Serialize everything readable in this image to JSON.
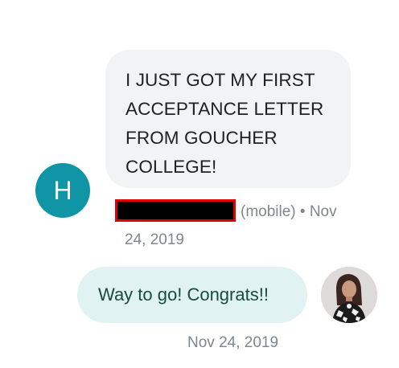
{
  "incoming": {
    "avatar_initial": "H",
    "avatar_color": "#0f95a5",
    "message": "I JUST GOT MY FIRST ACCEPTANCE LETTER FROM GOUCHER COLLEGE!",
    "sender_suffix": "(mobile) • Nov",
    "date_continued": "24, 2019"
  },
  "outgoing": {
    "message": "Way to go! Congrats!!",
    "timestamp": "Nov 24, 2019",
    "avatar_icon": "user-photo-avatar"
  },
  "colors": {
    "incoming_bubble": "#f1f3f4",
    "outgoing_bubble": "#e0f2f1",
    "outgoing_text": "#174b3f",
    "redaction_border": "#e00000"
  }
}
